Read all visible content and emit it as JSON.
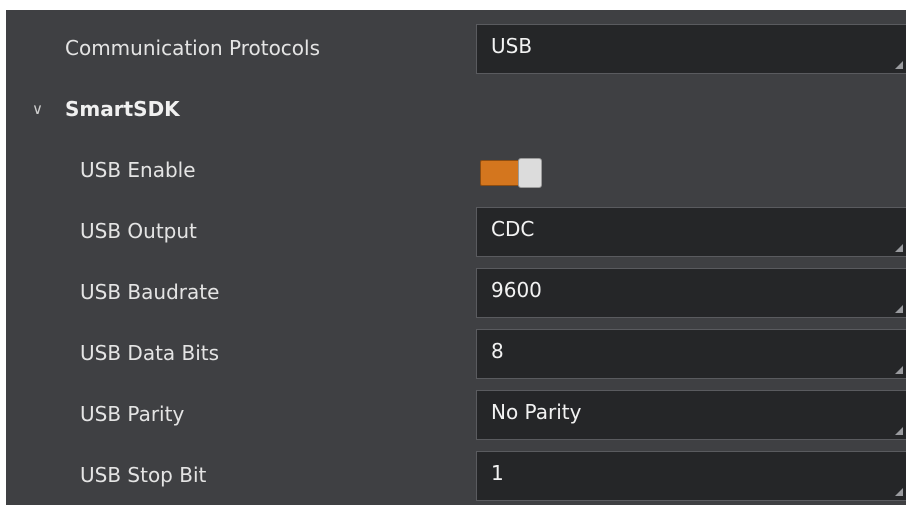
{
  "rows": {
    "communication_protocols": {
      "label": "Communication Protocols",
      "value": "USB"
    },
    "group": {
      "chevron": "∨",
      "label": "SmartSDK",
      "expanded": true
    },
    "usb_enable": {
      "label": "USB Enable",
      "enabled": true
    },
    "usb_output": {
      "label": "USB Output",
      "value": "CDC"
    },
    "usb_baudrate": {
      "label": "USB Baudrate",
      "value": "9600"
    },
    "usb_data_bits": {
      "label": "USB Data Bits",
      "value": "8"
    },
    "usb_parity": {
      "label": "USB Parity",
      "value": "No Parity"
    },
    "usb_stop_bit": {
      "label": "USB Stop Bit",
      "value": "1"
    }
  },
  "colors": {
    "panel_background": "#3f4043",
    "field_background": "#252628",
    "toggle_on": "#d4761e"
  },
  "icons": {
    "group_toggle": "chevron-down-icon",
    "resize_grip": "resize-grip-icon"
  }
}
